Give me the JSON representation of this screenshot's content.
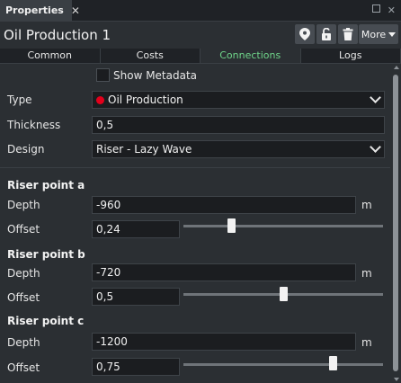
{
  "panel": {
    "tab_label": "Properties",
    "close_glyph": "✕"
  },
  "header": {
    "title": "Oil Production 1",
    "more_label": "More",
    "icons": [
      "location-pin-icon",
      "unlock-icon",
      "trash-icon"
    ]
  },
  "tabs": [
    {
      "label": "Common",
      "active": false
    },
    {
      "label": "Costs",
      "active": false
    },
    {
      "label": "Connections",
      "active": true
    },
    {
      "label": "Logs",
      "active": false
    }
  ],
  "form": {
    "show_metadata_label": "Show Metadata",
    "show_metadata_checked": false,
    "type_label": "Type",
    "type_value": "Oil Production",
    "type_color": "#e3001b",
    "thickness_label": "Thickness",
    "thickness_value": "0,5",
    "design_label": "Design",
    "design_value": "Riser - Lazy Wave"
  },
  "riser_points": [
    {
      "title": "Riser point a",
      "depth_label": "Depth",
      "depth_value": "-960",
      "unit": "m",
      "offset_label": "Offset",
      "offset_value": "0,24",
      "offset_fraction": 0.24
    },
    {
      "title": "Riser point b",
      "depth_label": "Depth",
      "depth_value": "-720",
      "unit": "m",
      "offset_label": "Offset",
      "offset_value": "0,5",
      "offset_fraction": 0.5
    },
    {
      "title": "Riser point c",
      "depth_label": "Depth",
      "depth_value": "-1200",
      "unit": "m",
      "offset_label": "Offset",
      "offset_value": "0,75",
      "offset_fraction": 0.75
    }
  ],
  "colors": {
    "active_tab": "#6fd58a",
    "background": "#2b2f33",
    "input_bg": "#1b1d20"
  }
}
